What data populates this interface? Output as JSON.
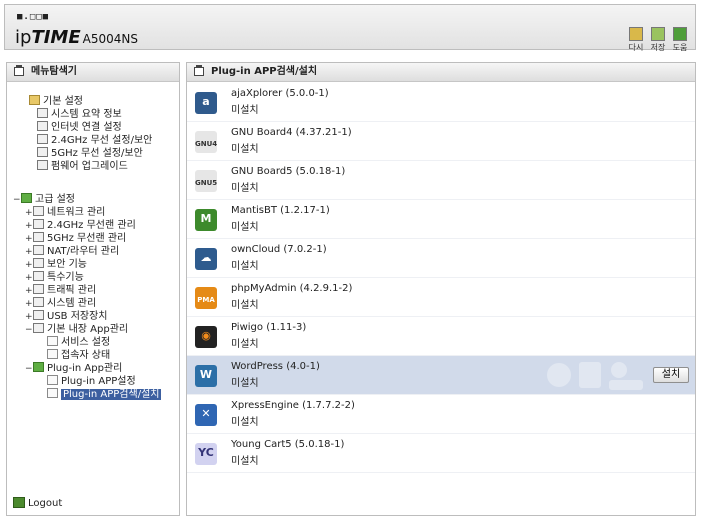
{
  "header": {
    "logo_dots": "■.□□■",
    "brand_ip": "ip",
    "brand_time": "TIME",
    "model": "A5004NS",
    "tools": [
      {
        "label": "다시",
        "icon": "refresh-icon",
        "color": "#d9b84a"
      },
      {
        "label": "저장",
        "icon": "save-icon",
        "color": "#9ac35f"
      },
      {
        "label": "도움",
        "icon": "help-icon",
        "color": "#4f9e3a"
      }
    ]
  },
  "sidebar": {
    "title": "메뉴탐색기",
    "basic_group": "기본 설정",
    "basic_items": [
      "시스템 요약 정보",
      "인터넷 연결 설정",
      "2.4GHz 무선 설정/보안",
      "5GHz 무선 설정/보안",
      "펌웨어 업그레이드"
    ],
    "advanced_group": "고급 설정",
    "advanced_items": [
      "네트워크 관리",
      "2.4GHz 무선랜 관리",
      "5GHz 무선랜 관리",
      "NAT/라우터 관리",
      "보안 기능",
      "특수기능",
      "트래픽 관리",
      "시스템 관리",
      "USB 저장장치"
    ],
    "builtin_group": "기본 내장 App관리",
    "builtin_items": [
      "서비스 설정",
      "접속자 상태"
    ],
    "plugin_group": "Plug-in App관리",
    "plugin_items": [
      "Plug-in APP설정",
      "Plug-in APP검색/설치"
    ],
    "logout": "Logout",
    "collapse_mark": "−",
    "expand_mark": "+"
  },
  "main": {
    "title": "Plug-in APP검색/설치",
    "install_label": "설치",
    "apps": [
      {
        "name": "ajaXplorer (5.0.0-1)",
        "status": "미설치",
        "icon_text": "a",
        "icon_bg": "#2f5a8c",
        "icon_fg": "#ffffff"
      },
      {
        "name": "GNU Board4 (4.37.21-1)",
        "status": "미설치",
        "icon_text": "GNU4",
        "icon_bg": "#e6e6e6",
        "icon_fg": "#333333"
      },
      {
        "name": "GNU Board5 (5.0.18-1)",
        "status": "미설치",
        "icon_text": "GNU5",
        "icon_bg": "#e6e6e6",
        "icon_fg": "#333333"
      },
      {
        "name": "MantisBT (1.2.17-1)",
        "status": "미설치",
        "icon_text": "M",
        "icon_bg": "#3d8a2c",
        "icon_fg": "#ffffff"
      },
      {
        "name": "ownCloud (7.0.2-1)",
        "status": "미설치",
        "icon_text": "☁",
        "icon_bg": "#2e5b8e",
        "icon_fg": "#ffffff"
      },
      {
        "name": "phpMyAdmin (4.2.9.1-2)",
        "status": "미설치",
        "icon_text": "PMA",
        "icon_bg": "#e58a16",
        "icon_fg": "#ffffff"
      },
      {
        "name": "Piwigo (1.11-3)",
        "status": "미설치",
        "icon_text": "◉",
        "icon_bg": "#222222",
        "icon_fg": "#f28c1c"
      },
      {
        "name": "WordPress (4.0-1)",
        "status": "미설치",
        "icon_text": "W",
        "icon_bg": "#2c6fa7",
        "icon_fg": "#ffffff"
      },
      {
        "name": "XpressEngine (1.7.7.2-2)",
        "status": "미설치",
        "icon_text": "✕",
        "icon_bg": "#2f66b3",
        "icon_fg": "#ffffff"
      },
      {
        "name": "Young Cart5 (5.0.18-1)",
        "status": "미설치",
        "icon_text": "YC",
        "icon_bg": "#d2d2f0",
        "icon_fg": "#333377"
      }
    ],
    "selected_index": 7
  }
}
